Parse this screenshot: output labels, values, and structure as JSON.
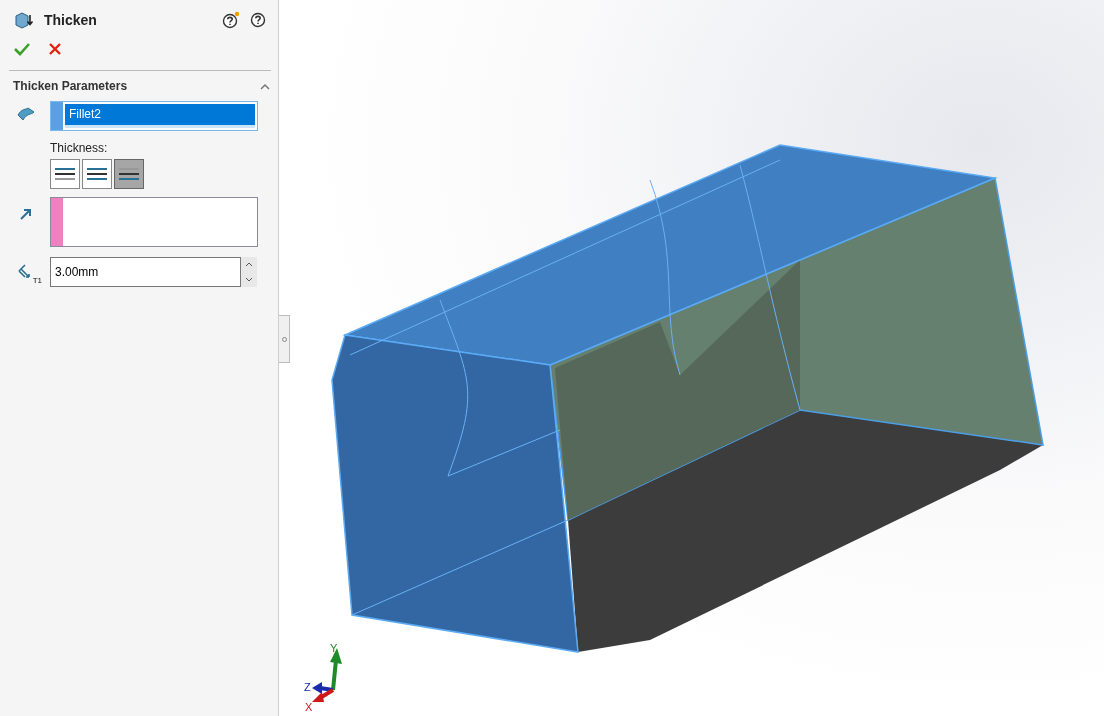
{
  "panel": {
    "title": "Thicken",
    "section": {
      "title": "Thicken Parameters",
      "expanded": true,
      "face_field": {
        "value": "Fillet2",
        "selected": true
      },
      "thickness_label": "Thickness:",
      "thickness_options": [
        {
          "kind": "side1",
          "selected": false
        },
        {
          "kind": "both",
          "selected": false
        },
        {
          "kind": "side2",
          "selected": true
        }
      ],
      "thickness_icon_label": "T1",
      "thickness_value": "3.00mm"
    }
  },
  "triad": {
    "y_label": "Y",
    "z_label": "Z",
    "x_label": "X"
  }
}
